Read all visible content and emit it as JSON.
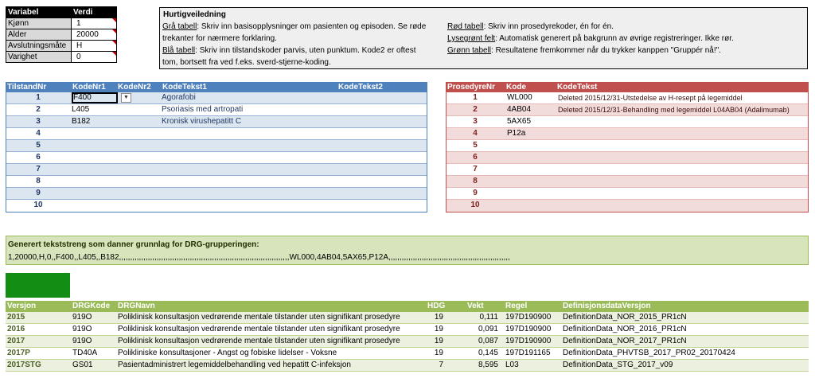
{
  "variables": {
    "header": {
      "col1": "Variabel",
      "col2": "Verdi"
    },
    "rows": [
      {
        "label": "Kjønn",
        "value": "1"
      },
      {
        "label": "Alder",
        "value": "20000"
      },
      {
        "label": "Avslutningsmåte",
        "value": "H"
      },
      {
        "label": "Varighet",
        "value": "0"
      }
    ]
  },
  "guide": {
    "title": "Hurtigveiledning",
    "left": [
      {
        "key": "Grå tabell",
        "text": ": Skriv inn basisopplysninger om pasienten og episoden. Se røde trekanter for nærmere forklaring."
      },
      {
        "key": "Blå tabell",
        "text": ": Skriv inn tilstandskoder parvis, uten punktum. Kode2 er oftest tom, bortsett fra ved f.eks. sverd-stjerne-koding."
      }
    ],
    "right": [
      {
        "key": "Rød tabell",
        "text": ": Skriv inn prosedyrekoder, én for én."
      },
      {
        "key": "Lysegrønt felt",
        "text": ": Automatisk generert på bakgrunn av øvrige registreringer. Ikke rør."
      },
      {
        "key": "Grønn tabell",
        "text": ": Resultatene fremkommer når du trykker kanppen \"Gruppér nå!\"."
      }
    ]
  },
  "diagnoses": {
    "headers": {
      "nr": "TilstandNr",
      "code1": "KodeNr1",
      "code2": "KodeNr2",
      "text1": "KodeTekst1",
      "text2": "KodeTekst2"
    },
    "rows": [
      {
        "nr": "1",
        "code1": "F400",
        "text1": "Agorafobi"
      },
      {
        "nr": "2",
        "code1": "L405",
        "text1": "Psoriasis med artropati"
      },
      {
        "nr": "3",
        "code1": "B182",
        "text1": "Kronisk virushepatitt C"
      },
      {
        "nr": "4",
        "code1": "",
        "text1": ""
      },
      {
        "nr": "5",
        "code1": "",
        "text1": ""
      },
      {
        "nr": "6",
        "code1": "",
        "text1": ""
      },
      {
        "nr": "7",
        "code1": "",
        "text1": ""
      },
      {
        "nr": "8",
        "code1": "",
        "text1": ""
      },
      {
        "nr": "9",
        "code1": "",
        "text1": ""
      },
      {
        "nr": "10",
        "code1": "",
        "text1": ""
      }
    ]
  },
  "procedures": {
    "headers": {
      "nr": "ProsedyreNr",
      "code": "Kode",
      "text": "KodeTekst"
    },
    "rows": [
      {
        "nr": "1",
        "code": "WL000",
        "text": "Deleted 2015/12/31-Utstedelse av H-resept på legemiddel"
      },
      {
        "nr": "2",
        "code": "4AB04",
        "text": "Deleted 2015/12/31-Behandling med legemiddel L04AB04 (Adalimumab)"
      },
      {
        "nr": "3",
        "code": "5AX65",
        "text": ""
      },
      {
        "nr": "4",
        "code": "P12a",
        "text": ""
      },
      {
        "nr": "5",
        "code": "",
        "text": ""
      },
      {
        "nr": "6",
        "code": "",
        "text": ""
      },
      {
        "nr": "7",
        "code": "",
        "text": ""
      },
      {
        "nr": "8",
        "code": "",
        "text": ""
      },
      {
        "nr": "9",
        "code": "",
        "text": ""
      },
      {
        "nr": "10",
        "code": "",
        "text": ""
      }
    ]
  },
  "generated": {
    "title": "Generert tekststreng som danner grunnlag for DRG-grupperingen:",
    "string": "1,20000,H,0,,F400,,L405,,B182,,,,,,,,,,,,,,,,,,,,,,,,,,,,,,,,,,,,,,,,,,,,,,,,,,,,,,,,,,,,,,,,,,,,,,,,,,,,,WL000,4AB04,5AX65,P12A,,,,,,,,,,,,,,,,,,,,,,,,,,,,,,,,,,,,,,,,,,,,,,,,,,,,,,,"
  },
  "group_button": {
    "color": "#138d13"
  },
  "results": {
    "headers": {
      "ver": "Versjon",
      "drg": "DRGKode",
      "name": "DRGNavn",
      "hdg": "HDG",
      "vekt": "Vekt",
      "regel": "Regel",
      "def": "DefinisjonsdataVersjon"
    },
    "rows": [
      {
        "ver": "2015",
        "drg": "919O",
        "name": "Poliklinisk konsultasjon vedrørende mentale tilstander uten signifikant prosedyre",
        "hdg": "19",
        "vekt": "0,111",
        "regel": "197D190900",
        "def": "DefinitionData_NOR_2015_PR1cN"
      },
      {
        "ver": "2016",
        "drg": "919O",
        "name": "Poliklinisk konsultasjon vedrørende mentale tilstander uten signifikant prosedyre",
        "hdg": "19",
        "vekt": "0,091",
        "regel": "197D190900",
        "def": "DefinitionData_NOR_2016_PR1cN"
      },
      {
        "ver": "2017",
        "drg": "919O",
        "name": "Poliklinisk konsultasjon vedrørende mentale tilstander uten signifikant prosedyre",
        "hdg": "19",
        "vekt": "0,087",
        "regel": "197D190900",
        "def": "DefinitionData_NOR_2017_PR1cN"
      },
      {
        "ver": "2017P",
        "drg": "TD40A",
        "name": "Polikliniske konsultasjoner - Angst og fobiske lidelser - Voksne",
        "hdg": "19",
        "vekt": "0,145",
        "regel": "197D191165",
        "def": "DefinitionData_PHVTSB_2017_PR02_20170424"
      },
      {
        "ver": "2017STG",
        "drg": "GS01",
        "name": "Pasientadministrert legemiddelbehandling ved hepatitt C-infeksjon",
        "hdg": "7",
        "vekt": "8,595",
        "regel": "L03",
        "def": "DefinitionData_STG_2017_v09"
      }
    ]
  }
}
